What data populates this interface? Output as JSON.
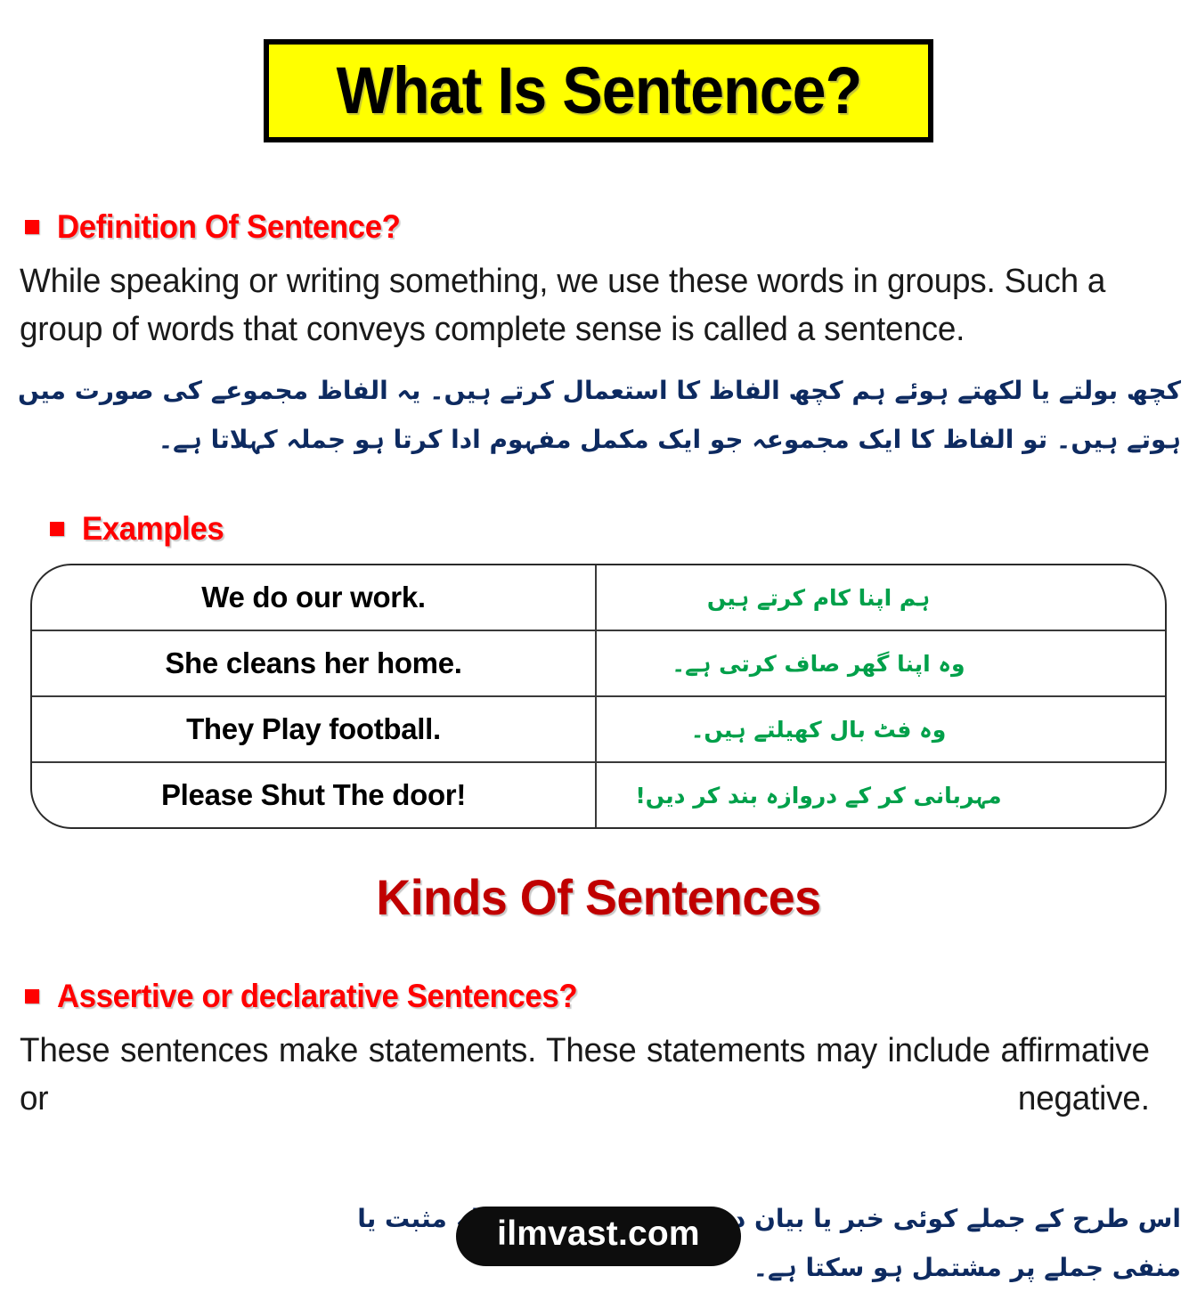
{
  "title": {
    "text": "What Is Sentence?",
    "background_color": "#ffff00",
    "border_color": "#000000",
    "text_color": "#000000"
  },
  "definition": {
    "heading": "Definition Of Sentence?",
    "heading_color": "#ff0000",
    "body_en": "While speaking or writing something, we use these words in groups. Such a group of words that conveys complete sense is called a sentence.",
    "body_ur": "کچھ بولتے یا لکھتے ہوئے ہم کچھ الفاظ کا استعمال کرتے ہیں۔ یہ الفاظ مجموعے کی صورت میں ہوتے ہیں۔ تو الفاظ کا ایک مجموعہ جو ایک مکمل مفہوم ادا کرتا ہو جملہ کہلاتا ہے۔",
    "urdu_color": "#0d2a60"
  },
  "examples": {
    "heading": "Examples",
    "heading_color": "#ff0000",
    "english_color": "#000000",
    "urdu_color": "#00a04a",
    "rows": [
      {
        "english": "We do our work.",
        "urdu": "ہم اپنا کام کرتے ہیں"
      },
      {
        "english": "She cleans her home.",
        "urdu": "وہ اپنا گھر صاف کرتی ہے۔"
      },
      {
        "english": "They Play football.",
        "urdu": "وہ فٹ بال کھیلتے ہیں۔"
      },
      {
        "english": "Please Shut The door!",
        "urdu": "مہربانی کر کے دروازہ بند کر دیں!"
      }
    ]
  },
  "kinds": {
    "heading": "Kinds Of Sentences",
    "heading_color": "#c00000"
  },
  "assertive": {
    "heading": "Assertive or declarative Sentences?",
    "heading_color": "#ff0000",
    "body_en": "These sentences make statements. These statements may include affirmative or negative.",
    "body_ur": "اس طرح کے جملے کوئی خبر یا بیان دیتے ہیں۔ یہ بیانیہ جملہ مثبت یا منفی جملے پر مشتمل ہو سکتا ہے۔",
    "urdu_color": "#0d2a60"
  },
  "footer": {
    "site": "ilmvast.com",
    "background_color": "#0d0d0d",
    "text_color": "#ffffff"
  }
}
